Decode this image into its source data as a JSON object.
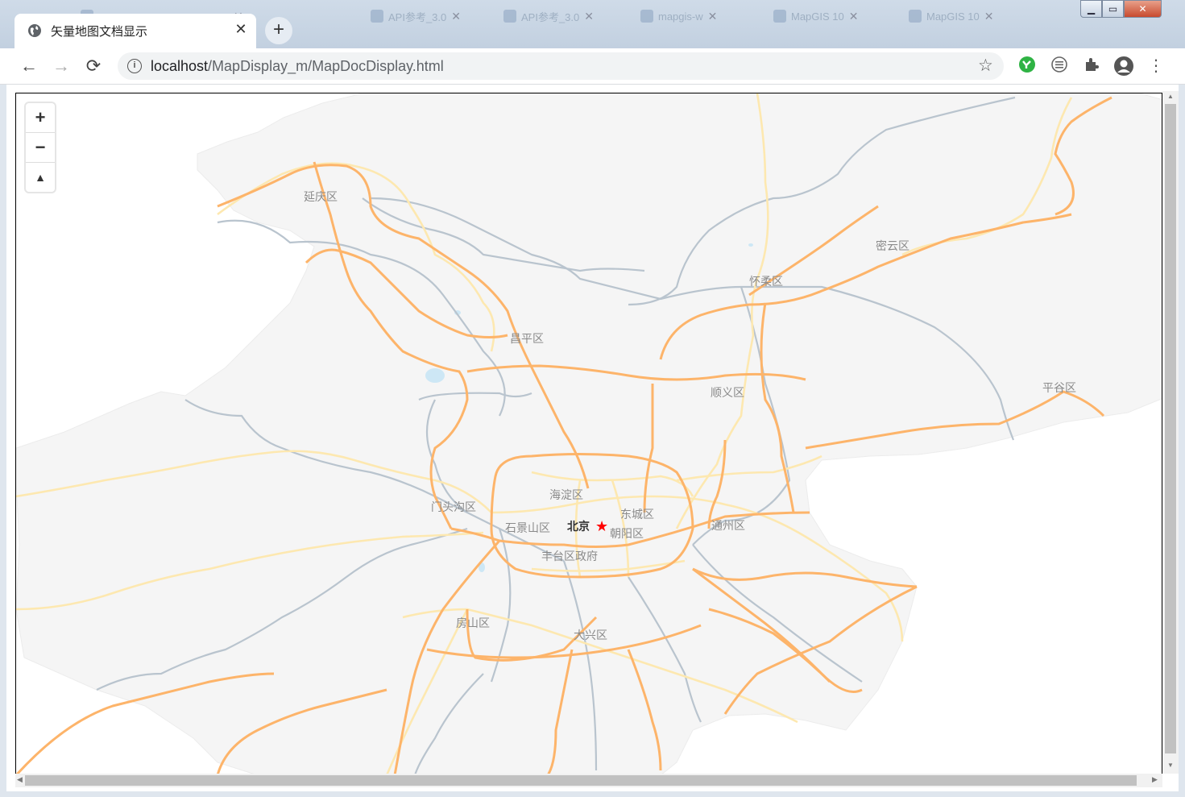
{
  "browser": {
    "active_tab": {
      "title": "矢量地图文档显示",
      "icon": "globe-icon"
    },
    "background_tabs": [
      {
        "label": "",
        "icon": "page-icon"
      },
      {
        "label": "API参考_3.0",
        "icon": "page-icon"
      },
      {
        "label": "API参考_3.0",
        "icon": "page-icon"
      },
      {
        "label": "mapgis-w",
        "icon": "cloud-icon"
      },
      {
        "label": "MapGIS 10",
        "icon": "globe-icon"
      },
      {
        "label": "MapGIS 10",
        "icon": "globe-icon"
      }
    ],
    "new_tab_label": "+",
    "url_host": "localhost",
    "url_path": "/MapDisplay_m/MapDocDisplay.html",
    "nav": {
      "back": "←",
      "forward": "→",
      "reload": "⟳"
    }
  },
  "map": {
    "controls": {
      "zoom_in": "+",
      "zoom_out": "−",
      "compass": "▲"
    },
    "capital": {
      "name": "北京",
      "marker": "★",
      "marker_color": "#ff0000"
    },
    "districts": [
      "延庆区",
      "密云区",
      "怀柔区",
      "昌平区",
      "顺义区",
      "平谷区",
      "海淀区",
      "门头沟区",
      "东城区",
      "石景山区",
      "朝阳区",
      "通州区",
      "丰台区政府",
      "房山区",
      "大兴区"
    ],
    "colors": {
      "land": "#f5f5f5",
      "highway": "#fdb46a",
      "road": "#fde8b0",
      "railway": "#b8c4cf",
      "water": "#cde7f5"
    }
  }
}
